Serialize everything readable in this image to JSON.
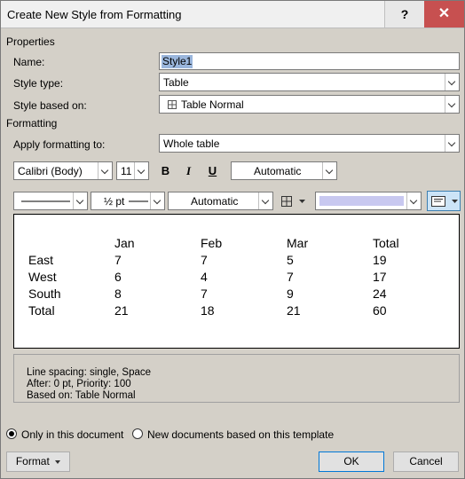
{
  "window": {
    "title": "Create New Style from Formatting",
    "help_glyph": "?",
    "close_glyph": "✕"
  },
  "properties": {
    "section_label": "Properties",
    "name_label": "Name:",
    "name_value": "Style1",
    "style_type_label": "Style type:",
    "style_type_value": "Table",
    "based_on_label": "Style based on:",
    "based_on_value": "Table Normal"
  },
  "formatting": {
    "section_label": "Formatting",
    "apply_to_label": "Apply formatting to:",
    "apply_to_value": "Whole table",
    "font_name": "Calibri (Body)",
    "font_size": "11",
    "bold": "B",
    "italic": "I",
    "underline": "U",
    "font_color": "Automatic",
    "line_width": "½ pt",
    "border_color": "Automatic",
    "shading_color": "#c8c8f0"
  },
  "preview": {
    "header": [
      "",
      "Jan",
      "Feb",
      "Mar",
      "Total"
    ],
    "rows": [
      [
        "East",
        "7",
        "7",
        "5",
        "19"
      ],
      [
        "West",
        "6",
        "4",
        "7",
        "17"
      ],
      [
        "South",
        "8",
        "7",
        "9",
        "24"
      ],
      [
        "Total",
        "21",
        "18",
        "21",
        "60"
      ]
    ]
  },
  "description": {
    "line1": "Line spacing:  single, Space",
    "line2": "After:  0 pt, Priority: 100",
    "line3": "Based on: Table Normal"
  },
  "options": {
    "only_this_document": "Only in this document",
    "new_documents": "New documents based on this template"
  },
  "buttons": {
    "format": "Format",
    "ok": "OK",
    "cancel": "Cancel"
  }
}
